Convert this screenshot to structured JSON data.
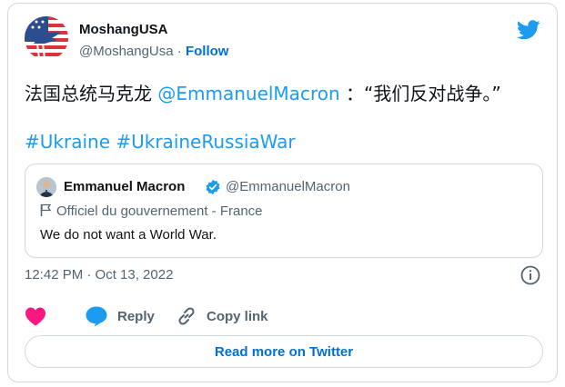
{
  "author": {
    "name": "MoshangUSA",
    "handle": "@MoshangUsa",
    "separator": " · ",
    "follow_label": "Follow"
  },
  "tweet": {
    "text_before": "法国总统马克龙 ",
    "mention": "@EmmanuelMacron",
    "text_after": " ：“我们反对战争。”",
    "hashtags": [
      "#Ukraine",
      "#UkraineRussiaWar"
    ]
  },
  "quoted": {
    "name": "Emmanuel Macron",
    "handle": "@EmmanuelMacron",
    "label": "Officiel du gouvernement - France",
    "text": "We do not want a World War."
  },
  "timestamp": "12:42 PM · Oct 13, 2022",
  "actions": {
    "like_icon": "heart-icon",
    "reply_label": "Reply",
    "copy_label": "Copy link"
  },
  "read_more_label": "Read more on Twitter",
  "colors": {
    "link": "#1d9bf0",
    "heart": "#f91880",
    "text": "#0f1419",
    "muted": "#536471"
  }
}
